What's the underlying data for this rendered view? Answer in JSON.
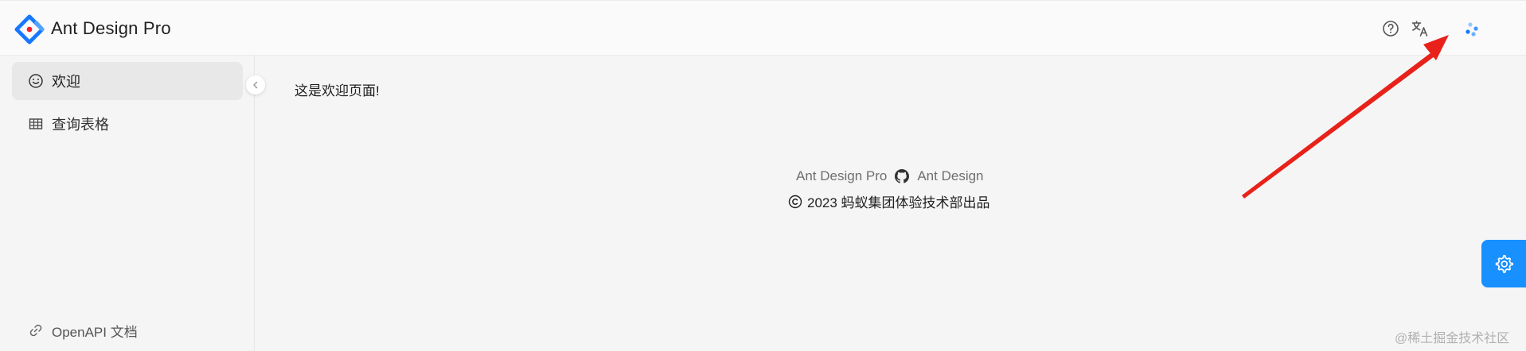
{
  "header": {
    "app_title": "Ant Design Pro",
    "icons": {
      "help": "question-circle-icon",
      "language": "translate-icon",
      "avatar": "avatar-loading-icon"
    }
  },
  "sidebar": {
    "items": [
      {
        "label": "欢迎",
        "icon": "smile-icon",
        "active": true
      },
      {
        "label": "查询表格",
        "icon": "table-icon",
        "active": false
      }
    ],
    "bottom_item": {
      "label": "OpenAPI 文档",
      "icon": "link-icon"
    }
  },
  "main": {
    "welcome_text": "这是欢迎页面!"
  },
  "footer": {
    "links": [
      "Ant Design Pro",
      "Ant Design"
    ],
    "copyright": "2023 蚂蚁集团体验技术部出品"
  },
  "watermark": "@稀土掘金技术社区",
  "colors": {
    "primary": "#1890ff",
    "logo_blue": "#1677ff",
    "logo_red": "#f5222d",
    "arrow": "#e8221a"
  }
}
